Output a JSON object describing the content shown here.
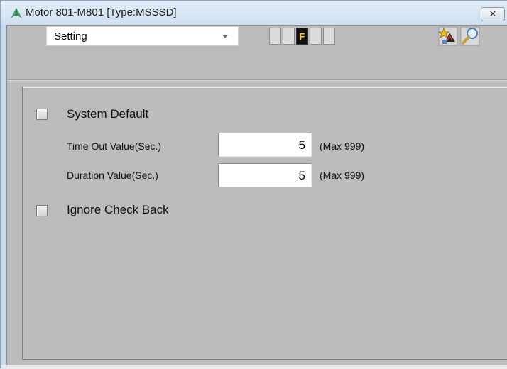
{
  "window": {
    "title": "Motor 801-M801  [Type:MSSSD]",
    "close_symbol": "✕"
  },
  "toolbar": {
    "mode_select": {
      "value": "Setting"
    },
    "indicators": [
      {
        "label": "",
        "lit": false
      },
      {
        "label": "",
        "lit": false
      },
      {
        "label": "F",
        "lit": true
      },
      {
        "label": "",
        "lit": false
      },
      {
        "label": "",
        "lit": false
      }
    ],
    "tools": [
      {
        "icon": "magic-wand-icon"
      },
      {
        "icon": "magnifier-icon"
      }
    ]
  },
  "settings": {
    "system_default": {
      "label": "System Default",
      "checked": false
    },
    "time_out": {
      "label": "Time Out Value(Sec.)",
      "value": "5",
      "max_label": "(Max 999)"
    },
    "duration": {
      "label": "Duration Value(Sec.)",
      "value": "5",
      "max_label": "(Max 999)"
    },
    "ignore_check_back": {
      "label": "Ignore Check Back",
      "checked": false
    }
  },
  "colors": {
    "panel_bg": "#bcbcbc",
    "titlebar_bg": "#cfdff1",
    "indicator_lit": "#111111",
    "indicator_text": "#ffd400"
  }
}
